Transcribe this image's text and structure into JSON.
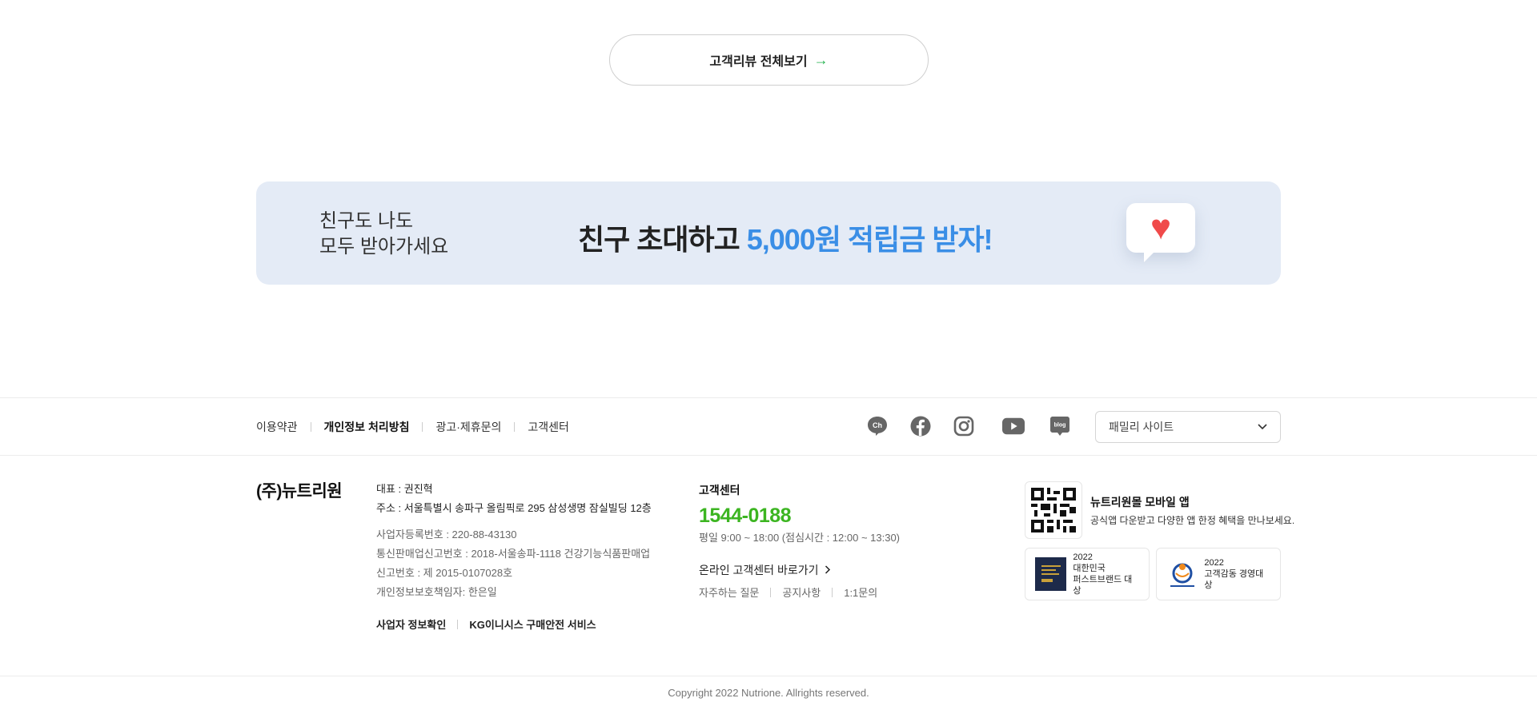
{
  "review": {
    "label": "고객리뷰 전체보기",
    "arrow": "→"
  },
  "banner": {
    "left_line1": "친구도 나도",
    "left_line2": "모두 받아가세요",
    "main_text": "친구 초대하고",
    "highlight_text": "5,000원 적립금 받자!",
    "heart": "♥"
  },
  "footer_links": [
    "이용약관",
    "개인정보 처리방침",
    "광고·제휴문의",
    "고객센터"
  ],
  "socials": [
    "kakao-channel-icon",
    "facebook-icon",
    "instagram-icon",
    "youtube-icon",
    "blog-icon"
  ],
  "social_labels": {
    "channel": "Ch",
    "blog": "blog"
  },
  "family_site": {
    "label": "패밀리 사이트",
    "chevron": "⌄"
  },
  "company": {
    "logo": "(주)뉴트리원",
    "ceo": "대표 : 권진혁",
    "address": "주소 : 서울특별시 송파구 올림픽로 295 삼성생명 잠실빌딩 12층",
    "biz_number": "사업자등록번호 : 220-88-43130",
    "mail_order": "통신판매업신고번호 : 2018-서울송파-1118 건강기능식품판매업",
    "report_number": "신고번호 : 제 2015-0107028호",
    "privacy_officer": "개인정보보호책임자: 한은일",
    "biz_info_link": "사업자 정보확인",
    "kg_link": "KG이니시스 구매안전 서비스"
  },
  "customer_center": {
    "title": "고객센터",
    "phone": "1544-0188",
    "hours": "평일 9:00 ~ 18:00 (점심시간 : 12:00 ~ 13:30)",
    "online_link": "온라인 고객센터 바로가기",
    "faq": "자주하는 질문",
    "notice": "공지사항",
    "inquiry": "1:1문의"
  },
  "app": {
    "title": "뉴트리원몰 모바일 앱",
    "desc": "공식앱 다운받고 다양한 앱 한정 혜택을 만나보세요."
  },
  "awards": [
    {
      "year": "2022",
      "line1": "대한민국",
      "line2": "퍼스트브랜드 대상"
    },
    {
      "year": "2022",
      "line1": "고객감동 경영대상",
      "line2": ""
    }
  ],
  "copyright": "Copyright 2022 Nutrione. Allrights reserved."
}
